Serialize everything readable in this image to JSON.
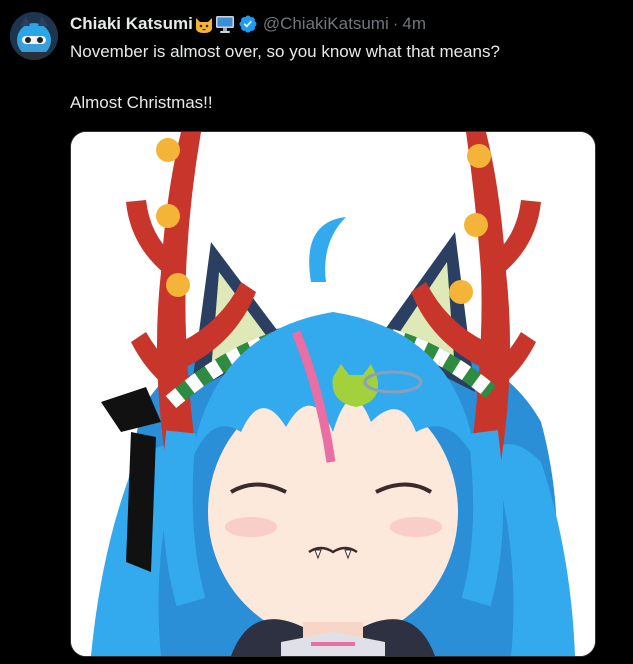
{
  "tweet": {
    "display_name": "Chiaki Katsumi",
    "name_emojis": [
      "cat-face-emoji",
      "desktop-computer-emoji"
    ],
    "verified": true,
    "handle": "@ChiakiKatsumi",
    "separator": "·",
    "time": "4m",
    "text_line1": "November is almost over, so you know what that means?",
    "text_line2": "Almost Christmas!!"
  },
  "media": {
    "type": "illustration",
    "subject": "anime-girl-with-reindeer-antlers-and-bells"
  },
  "colors": {
    "background": "#000000",
    "text_primary": "#e7e9ea",
    "text_secondary": "#71767b",
    "verified_blue": "#1d9bf0"
  }
}
